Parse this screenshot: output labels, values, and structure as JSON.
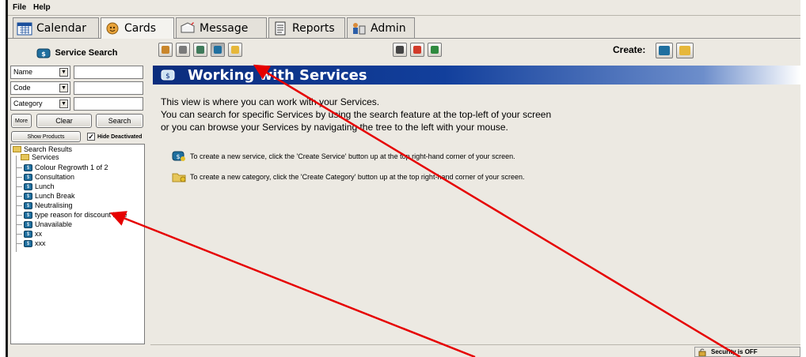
{
  "menu": {
    "items": [
      "File",
      "Help"
    ]
  },
  "tabs": [
    {
      "label": "Calendar",
      "icon": "calendar-icon"
    },
    {
      "label": "Cards",
      "icon": "cards-icon"
    },
    {
      "label": "Message",
      "icon": "message-icon"
    },
    {
      "label": "Reports",
      "icon": "reports-icon"
    },
    {
      "label": "Admin",
      "icon": "admin-icon"
    }
  ],
  "active_tab": "Cards",
  "search": {
    "title": "Service Search",
    "fields": [
      {
        "label": "Name",
        "value": ""
      },
      {
        "label": "Code",
        "value": ""
      },
      {
        "label": "Category",
        "value": ""
      }
    ],
    "more_label": "More",
    "clear_label": "Clear",
    "search_label": "Search",
    "show_products_label": "Show Products",
    "hide_deactivated_label": "Hide Deactivated",
    "hide_deactivated_checked": true
  },
  "tree": {
    "root": "Search Results",
    "folder": "Services",
    "items": [
      "Colour Regrowth 1 of 2",
      "Consultation",
      "Lunch",
      "Lunch Break",
      "Neutralising",
      "type reason for discount here",
      "Unavailable",
      "xx",
      "xxx"
    ]
  },
  "toolbar": {
    "create_label": "Create:"
  },
  "content": {
    "banner_title": "Working with Services",
    "intro_lines": [
      "This view is where you can work with your Services.",
      "You can search for specific Services by using the search feature at the top-left of your screen",
      "or you can browse your Services by navigating the tree to the left with your mouse."
    ],
    "hint_service": "To create a new service, click the 'Create Service' button up at the top right-hand corner of your screen.",
    "hint_category": "To create a new category, click the 'Create Category' button up at the top right-hand corner of your screen."
  },
  "status": {
    "security": "Security is OFF"
  },
  "colors": {
    "banner": "#0b2d7d",
    "annotation_arrow": "#e60000",
    "service_icon": "#1f6f9f",
    "folder": "#e6c65a"
  }
}
